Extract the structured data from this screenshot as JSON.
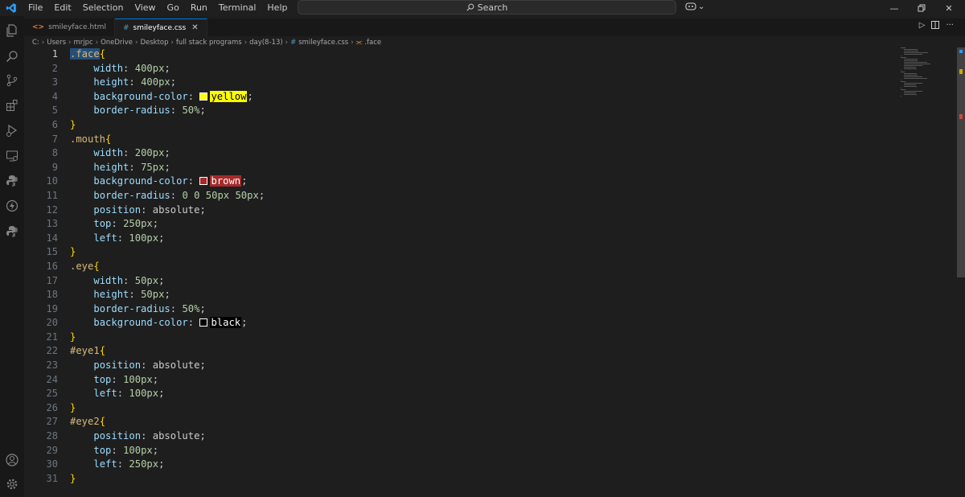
{
  "menu": [
    "File",
    "Edit",
    "Selection",
    "View",
    "Go",
    "Run",
    "Terminal",
    "Help"
  ],
  "search": {
    "label": "Search"
  },
  "tabs": [
    {
      "label": "smileyface.html",
      "icon": "html-file-icon",
      "color": "#e37933",
      "active": false
    },
    {
      "label": "smileyface.css",
      "icon": "css-file-icon",
      "color": "#519aba",
      "active": true
    }
  ],
  "breadcrumb": [
    "C:",
    "Users",
    "mrjpc",
    "OneDrive",
    "Desktop",
    "full stack programs",
    "day(8-13)",
    "smileyface.css",
    ".face"
  ],
  "editor": {
    "current_line": 1,
    "lines": [
      [
        {
          "t": ".face",
          "c": "sel",
          "h": true
        },
        {
          "t": "{",
          "c": "brace"
        }
      ],
      [
        {
          "t": "    "
        },
        {
          "t": "width",
          "c": "prop"
        },
        {
          "t": ": ",
          "c": "punc"
        },
        {
          "t": "400px",
          "c": "num"
        },
        {
          "t": ";",
          "c": "punc"
        }
      ],
      [
        {
          "t": "    "
        },
        {
          "t": "height",
          "c": "prop"
        },
        {
          "t": ": ",
          "c": "punc"
        },
        {
          "t": "400px",
          "c": "num"
        },
        {
          "t": ";",
          "c": "punc"
        }
      ],
      [
        {
          "t": "    "
        },
        {
          "t": "background-color",
          "c": "prop"
        },
        {
          "t": ": ",
          "c": "punc"
        },
        {
          "sw": "#ffff00"
        },
        {
          "t": "yellow",
          "c": "colorword",
          "bg": "#ffff00",
          "fg": "#000000"
        },
        {
          "t": ";",
          "c": "punc"
        }
      ],
      [
        {
          "t": "    "
        },
        {
          "t": "border-radius",
          "c": "prop"
        },
        {
          "t": ": ",
          "c": "punc"
        },
        {
          "t": "50%",
          "c": "num"
        },
        {
          "t": ";",
          "c": "punc"
        }
      ],
      [
        {
          "t": "}",
          "c": "brace"
        }
      ],
      [
        {
          "t": ".mouth",
          "c": "sel"
        },
        {
          "t": "{",
          "c": "brace"
        }
      ],
      [
        {
          "t": "    "
        },
        {
          "t": "width",
          "c": "prop"
        },
        {
          "t": ": ",
          "c": "punc"
        },
        {
          "t": "200px",
          "c": "num"
        },
        {
          "t": ";",
          "c": "punc"
        }
      ],
      [
        {
          "t": "    "
        },
        {
          "t": "height",
          "c": "prop"
        },
        {
          "t": ": ",
          "c": "punc"
        },
        {
          "t": "75px",
          "c": "num"
        },
        {
          "t": ";",
          "c": "punc"
        }
      ],
      [
        {
          "t": "    "
        },
        {
          "t": "background-color",
          "c": "prop"
        },
        {
          "t": ": ",
          "c": "punc"
        },
        {
          "sw": "#a52a2a"
        },
        {
          "t": "brown",
          "c": "colorword",
          "bg": "#a52a2a",
          "fg": "#ffffff"
        },
        {
          "t": ";",
          "c": "punc"
        }
      ],
      [
        {
          "t": "    "
        },
        {
          "t": "border-radius",
          "c": "prop"
        },
        {
          "t": ": ",
          "c": "punc"
        },
        {
          "t": "0 0 50px 50px",
          "c": "num"
        },
        {
          "t": ";",
          "c": "punc"
        }
      ],
      [
        {
          "t": "    "
        },
        {
          "t": "position",
          "c": "prop"
        },
        {
          "t": ": ",
          "c": "punc"
        },
        {
          "t": "absolute",
          "c": "kw"
        },
        {
          "t": ";",
          "c": "punc"
        }
      ],
      [
        {
          "t": "    "
        },
        {
          "t": "top",
          "c": "prop"
        },
        {
          "t": ": ",
          "c": "punc"
        },
        {
          "t": "250px",
          "c": "num"
        },
        {
          "t": ";",
          "c": "punc"
        }
      ],
      [
        {
          "t": "    "
        },
        {
          "t": "left",
          "c": "prop"
        },
        {
          "t": ": ",
          "c": "punc"
        },
        {
          "t": "100px",
          "c": "num"
        },
        {
          "t": ";",
          "c": "punc"
        }
      ],
      [
        {
          "t": "}",
          "c": "brace"
        }
      ],
      [
        {
          "t": ".eye",
          "c": "sel"
        },
        {
          "t": "{",
          "c": "brace"
        }
      ],
      [
        {
          "t": "    "
        },
        {
          "t": "width",
          "c": "prop"
        },
        {
          "t": ": ",
          "c": "punc"
        },
        {
          "t": "50px",
          "c": "num"
        },
        {
          "t": ";",
          "c": "punc"
        }
      ],
      [
        {
          "t": "    "
        },
        {
          "t": "height",
          "c": "prop"
        },
        {
          "t": ": ",
          "c": "punc"
        },
        {
          "t": "50px",
          "c": "num"
        },
        {
          "t": ";",
          "c": "punc"
        }
      ],
      [
        {
          "t": "    "
        },
        {
          "t": "border-radius",
          "c": "prop"
        },
        {
          "t": ": ",
          "c": "punc"
        },
        {
          "t": "50%",
          "c": "num"
        },
        {
          "t": ";",
          "c": "punc"
        }
      ],
      [
        {
          "t": "    "
        },
        {
          "t": "background-color",
          "c": "prop"
        },
        {
          "t": ": ",
          "c": "punc"
        },
        {
          "sw": "#000000"
        },
        {
          "t": "black",
          "c": "colorword",
          "bg": "#000000",
          "fg": "#ffffff"
        },
        {
          "t": ";",
          "c": "punc"
        }
      ],
      [
        {
          "t": "}",
          "c": "brace"
        }
      ],
      [
        {
          "t": "#eye1",
          "c": "sel"
        },
        {
          "t": "{",
          "c": "brace"
        }
      ],
      [
        {
          "t": "    "
        },
        {
          "t": "position",
          "c": "prop"
        },
        {
          "t": ": ",
          "c": "punc"
        },
        {
          "t": "absolute",
          "c": "kw"
        },
        {
          "t": ";",
          "c": "punc"
        }
      ],
      [
        {
          "t": "    "
        },
        {
          "t": "top",
          "c": "prop"
        },
        {
          "t": ": ",
          "c": "punc"
        },
        {
          "t": "100px",
          "c": "num"
        },
        {
          "t": ";",
          "c": "punc"
        }
      ],
      [
        {
          "t": "    "
        },
        {
          "t": "left",
          "c": "prop"
        },
        {
          "t": ": ",
          "c": "punc"
        },
        {
          "t": "100px",
          "c": "num"
        },
        {
          "t": ";",
          "c": "punc"
        }
      ],
      [
        {
          "t": "}",
          "c": "brace"
        }
      ],
      [
        {
          "t": "#eye2",
          "c": "sel"
        },
        {
          "t": "{",
          "c": "brace"
        }
      ],
      [
        {
          "t": "    "
        },
        {
          "t": "position",
          "c": "prop"
        },
        {
          "t": ": ",
          "c": "punc"
        },
        {
          "t": "absolute",
          "c": "kw"
        },
        {
          "t": ";",
          "c": "punc"
        }
      ],
      [
        {
          "t": "    "
        },
        {
          "t": "top",
          "c": "prop"
        },
        {
          "t": ": ",
          "c": "punc"
        },
        {
          "t": "100px",
          "c": "num"
        },
        {
          "t": ";",
          "c": "punc"
        }
      ],
      [
        {
          "t": "    "
        },
        {
          "t": "left",
          "c": "prop"
        },
        {
          "t": ": ",
          "c": "punc"
        },
        {
          "t": "250px",
          "c": "num"
        },
        {
          "t": ";",
          "c": "punc"
        }
      ],
      [
        {
          "t": "}",
          "c": "brace"
        }
      ]
    ]
  },
  "colors": {
    "accent": "#0078d4",
    "editor_bg": "#1e1e1e",
    "yellow_mark": "#cca700",
    "red_mark": "#c74e39"
  }
}
